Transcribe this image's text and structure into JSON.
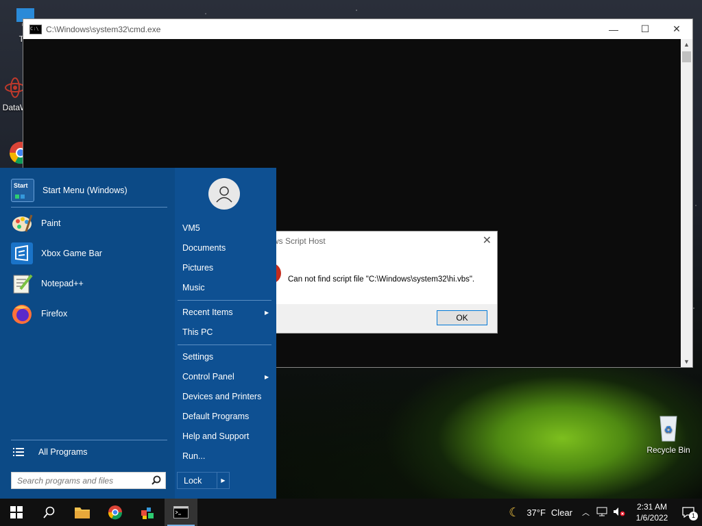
{
  "desktop": {
    "icons": [
      {
        "label": "Thi"
      },
      {
        "label": "DataW"
      },
      {
        "label": "Recycle Bin"
      }
    ]
  },
  "cmd_window": {
    "title": "C:\\Windows\\system32\\cmd.exe",
    "minimize": "—",
    "maximize": "☐",
    "close": "✕"
  },
  "dialog": {
    "title": "ws Script Host",
    "message": "Can not find script file \"C:\\Windows\\system32\\hi.vbs\".",
    "ok_label": "OK",
    "close": "✕"
  },
  "start_menu": {
    "pinned": [
      {
        "label": "Start Menu (Windows)"
      },
      {
        "label": "Paint"
      },
      {
        "label": "Xbox Game Bar"
      },
      {
        "label": "Notepad++"
      },
      {
        "label": "Firefox"
      }
    ],
    "all_programs": "All Programs",
    "search_placeholder": "Search programs and files",
    "right_items": [
      "VM5",
      "Documents",
      "Pictures",
      "Music",
      "Recent Items",
      "This PC",
      "Settings",
      "Control Panel",
      "Devices and Printers",
      "Default Programs",
      "Help and Support",
      "Run..."
    ],
    "lock_label": "Lock",
    "start_icon_text": "Start"
  },
  "taskbar": {
    "weather_temp": "37°F",
    "weather_cond": "Clear",
    "time": "2:31 AM",
    "date": "1/6/2022",
    "notification_count": "1"
  }
}
